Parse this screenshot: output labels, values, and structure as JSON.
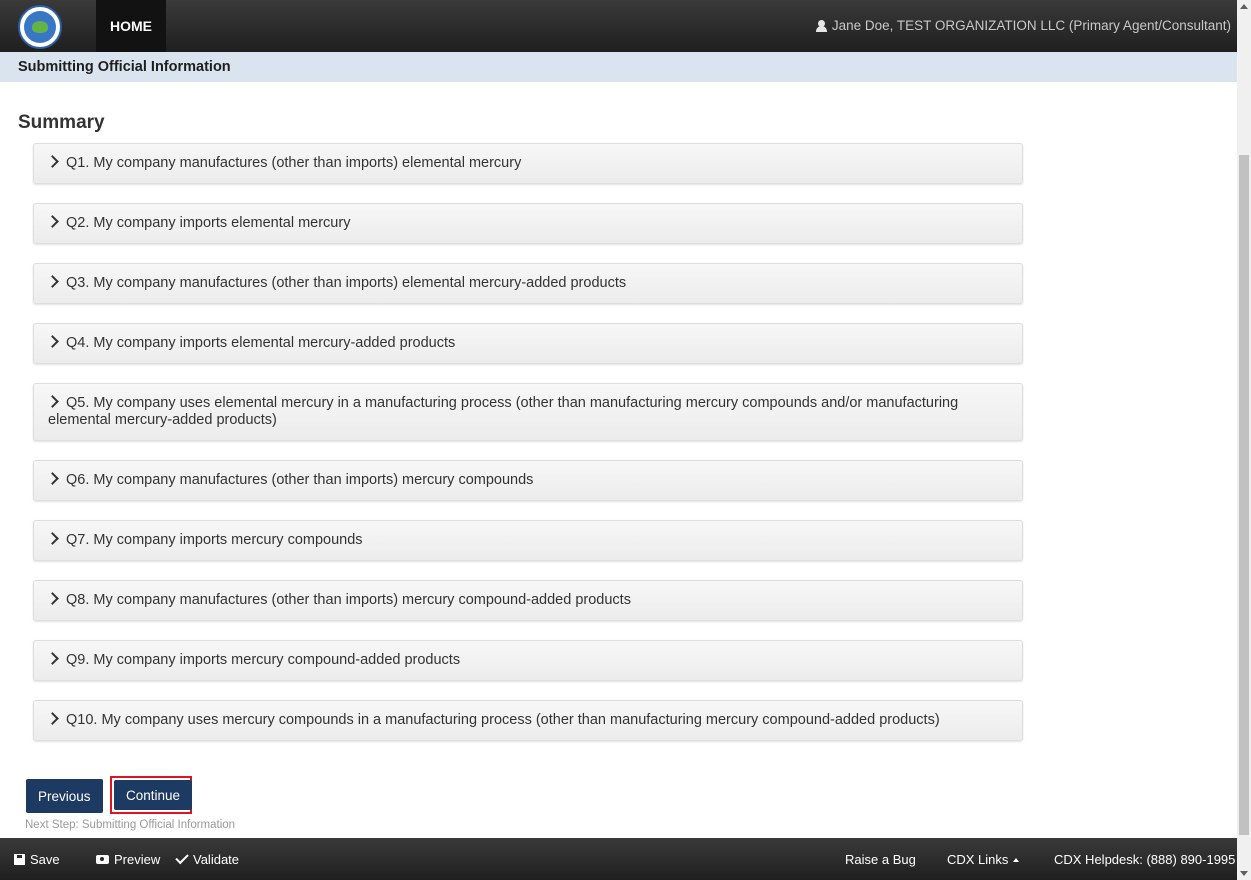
{
  "header": {
    "logo_icon": "epa-seal-icon",
    "home_label": "HOME",
    "user_label": "Jane Doe, TEST ORGANIZATION LLC (Primary Agent/Consultant)"
  },
  "section": {
    "title": "Submitting Official Information"
  },
  "summary": {
    "heading": "Summary",
    "questions": [
      {
        "label": "Q1. My company manufactures (other than imports) elemental mercury"
      },
      {
        "label": "Q2. My company imports elemental mercury"
      },
      {
        "label": "Q3. My company manufactures (other than imports) elemental mercury-added products"
      },
      {
        "label": "Q4. My company imports elemental mercury-added products"
      },
      {
        "label": "Q5. My company uses elemental mercury in a manufacturing process (other than manufacturing mercury compounds and/or manufacturing elemental mercury-added products)"
      },
      {
        "label": "Q6. My company manufactures (other than imports) mercury compounds"
      },
      {
        "label": "Q7. My company imports mercury compounds"
      },
      {
        "label": "Q8. My company manufactures (other than imports) mercury compound-added products"
      },
      {
        "label": "Q9. My company imports mercury compound-added products"
      },
      {
        "label": "Q10. My company uses mercury compounds in a manufacturing process (other than manufacturing mercury compound-added products)"
      }
    ]
  },
  "nav": {
    "previous_label": "Previous",
    "continue_label": "Continue",
    "next_step_text": "Next Step: Submitting Official Information"
  },
  "footer": {
    "save_label": "Save",
    "preview_label": "Preview",
    "validate_label": "Validate",
    "raise_bug_label": "Raise a Bug",
    "cdx_links_label": "CDX Links",
    "helpdesk_label": "CDX Helpdesk: (888) 890-1995"
  },
  "colors": {
    "topbar": "#2a2a2a",
    "section_bar": "#d9e4ef",
    "button": "#1d3a63",
    "highlight": "#e0141e"
  }
}
